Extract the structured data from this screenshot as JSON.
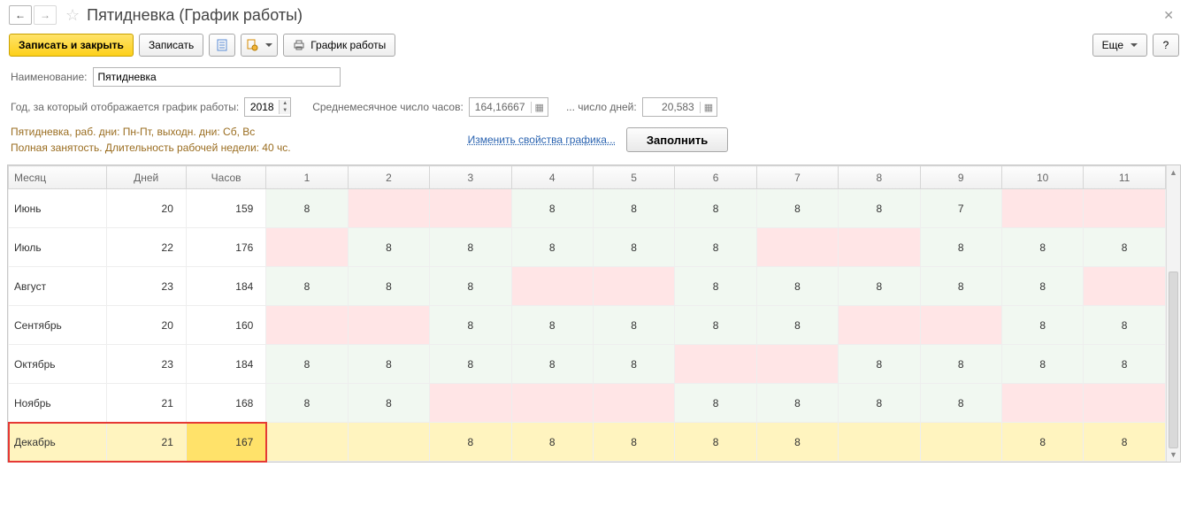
{
  "header": {
    "title": "Пятидневка (График работы)"
  },
  "toolbar": {
    "save_close": "Записать и закрыть",
    "save": "Записать",
    "print_label": "График работы",
    "more": "Еще",
    "help": "?"
  },
  "form": {
    "name_label": "Наименование:",
    "name_value": "Пятидневка",
    "year_label": "Год, за который отображается график работы:",
    "year_value": "2018",
    "avg_hours_label": "Среднемесячное число часов:",
    "avg_hours_value": "164,16667",
    "avg_days_label": "... число дней:",
    "avg_days_value": "20,583"
  },
  "desc": {
    "line1": "Пятидневка, раб. дни: Пн-Пт, выходн. дни: Сб, Вс",
    "line2": "Полная занятость. Длительность рабочей недели: 40 чс.",
    "change_link": "Изменить свойства графика...",
    "fill_btn": "Заполнить"
  },
  "grid": {
    "headers": {
      "month": "Месяц",
      "days": "Дней",
      "hours": "Часов"
    },
    "day_cols": [
      "1",
      "2",
      "3",
      "4",
      "5",
      "6",
      "7",
      "8",
      "9",
      "10",
      "11"
    ],
    "rows": [
      {
        "month": "Июнь",
        "days": 20,
        "hours": 159,
        "cells": [
          {
            "v": "8"
          },
          {
            "w": true
          },
          {
            "w": true
          },
          {
            "v": "8"
          },
          {
            "v": "8"
          },
          {
            "v": "8"
          },
          {
            "v": "8"
          },
          {
            "v": "8"
          },
          {
            "v": "7"
          },
          {
            "w": true
          },
          {
            "w": true
          }
        ]
      },
      {
        "month": "Июль",
        "days": 22,
        "hours": 176,
        "cells": [
          {
            "w": true
          },
          {
            "v": "8"
          },
          {
            "v": "8"
          },
          {
            "v": "8"
          },
          {
            "v": "8"
          },
          {
            "v": "8"
          },
          {
            "w": true
          },
          {
            "w": true
          },
          {
            "v": "8"
          },
          {
            "v": "8"
          },
          {
            "v": "8"
          }
        ]
      },
      {
        "month": "Август",
        "days": 23,
        "hours": 184,
        "cells": [
          {
            "v": "8"
          },
          {
            "v": "8"
          },
          {
            "v": "8"
          },
          {
            "w": true
          },
          {
            "w": true
          },
          {
            "v": "8"
          },
          {
            "v": "8"
          },
          {
            "v": "8"
          },
          {
            "v": "8"
          },
          {
            "v": "8"
          },
          {
            "w": true
          }
        ]
      },
      {
        "month": "Сентябрь",
        "days": 20,
        "hours": 160,
        "cells": [
          {
            "w": true
          },
          {
            "w": true
          },
          {
            "v": "8"
          },
          {
            "v": "8"
          },
          {
            "v": "8"
          },
          {
            "v": "8"
          },
          {
            "v": "8"
          },
          {
            "w": true
          },
          {
            "w": true
          },
          {
            "v": "8"
          },
          {
            "v": "8"
          }
        ]
      },
      {
        "month": "Октябрь",
        "days": 23,
        "hours": 184,
        "cells": [
          {
            "v": "8"
          },
          {
            "v": "8"
          },
          {
            "v": "8"
          },
          {
            "v": "8"
          },
          {
            "v": "8"
          },
          {
            "w": true
          },
          {
            "w": true
          },
          {
            "v": "8"
          },
          {
            "v": "8"
          },
          {
            "v": "8"
          },
          {
            "v": "8"
          }
        ]
      },
      {
        "month": "Ноябрь",
        "days": 21,
        "hours": 168,
        "cells": [
          {
            "v": "8"
          },
          {
            "v": "8"
          },
          {
            "w": true
          },
          {
            "w": true
          },
          {
            "w": true
          },
          {
            "v": "8"
          },
          {
            "v": "8"
          },
          {
            "v": "8"
          },
          {
            "v": "8"
          },
          {
            "w": true
          },
          {
            "w": true
          }
        ]
      },
      {
        "month": "Декабрь",
        "days": 21,
        "hours": 167,
        "sel": true,
        "cells": [
          {
            "w": true
          },
          {
            "w": true
          },
          {
            "v": "8"
          },
          {
            "v": "8"
          },
          {
            "v": "8"
          },
          {
            "v": "8"
          },
          {
            "v": "8"
          },
          {
            "w": true
          },
          {
            "w": true
          },
          {
            "v": "8"
          },
          {
            "v": "8"
          }
        ]
      }
    ]
  }
}
